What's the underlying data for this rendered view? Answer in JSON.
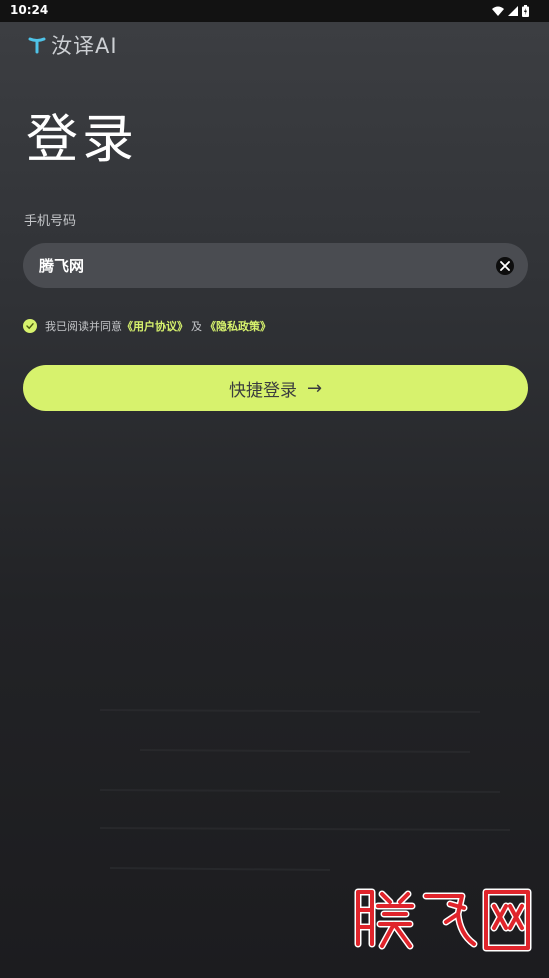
{
  "status_bar": {
    "time": "10:24",
    "icons": [
      "wifi-icon",
      "signal-icon",
      "battery-icon"
    ]
  },
  "brand": {
    "name": "汝译AI",
    "icon": "y-logo-icon",
    "accent_color": "#4fc3e8"
  },
  "page": {
    "title": "登录"
  },
  "login_form": {
    "phone_label": "手机号码",
    "phone_value": "腾飞网",
    "clear_icon": "clear-icon",
    "agreement_prefix": "我已阅读并同意",
    "user_agreement_link": "《用户协议》",
    "and_text": "及",
    "privacy_policy_link": "《隐私政策》",
    "agreement_checked": true,
    "submit_label": "快捷登录",
    "submit_arrow": "→",
    "accent_color": "#d7f26d"
  },
  "watermark": {
    "text": "腾飞网",
    "color": "#e0242b"
  }
}
